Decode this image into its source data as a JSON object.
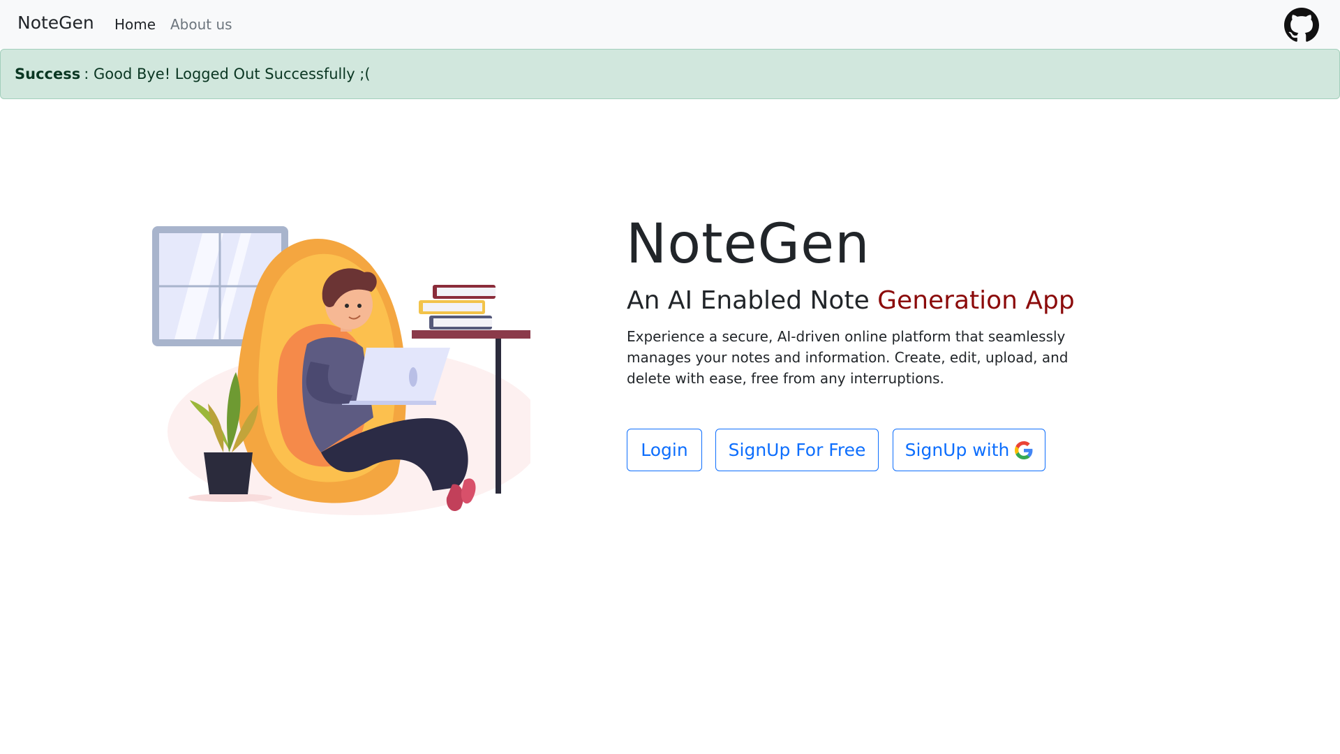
{
  "navbar": {
    "brand": "NoteGen",
    "links": [
      "Home",
      "About us"
    ],
    "github_icon": "github-icon"
  },
  "alert": {
    "label": "Success",
    "message": ": Good Bye! Logged Out Successfully ;("
  },
  "hero": {
    "title": "NoteGen",
    "subtitle_plain": "An AI Enabled Note ",
    "subtitle_accent": "Generation App",
    "description": "Experience a secure, AI-driven online platform that seamlessly manages your notes and information. Create, edit, upload, and delete with ease, free from any interruptions.",
    "buttons": {
      "login": "Login",
      "signup": "SignUp For Free",
      "google": "SignUp with"
    },
    "google_icon": "google-icon"
  },
  "colors": {
    "accent": "#8b0a0a",
    "primary": "#0d6efd",
    "alert_bg": "#d1e7dd",
    "navbar_bg": "#f8f9fa"
  }
}
